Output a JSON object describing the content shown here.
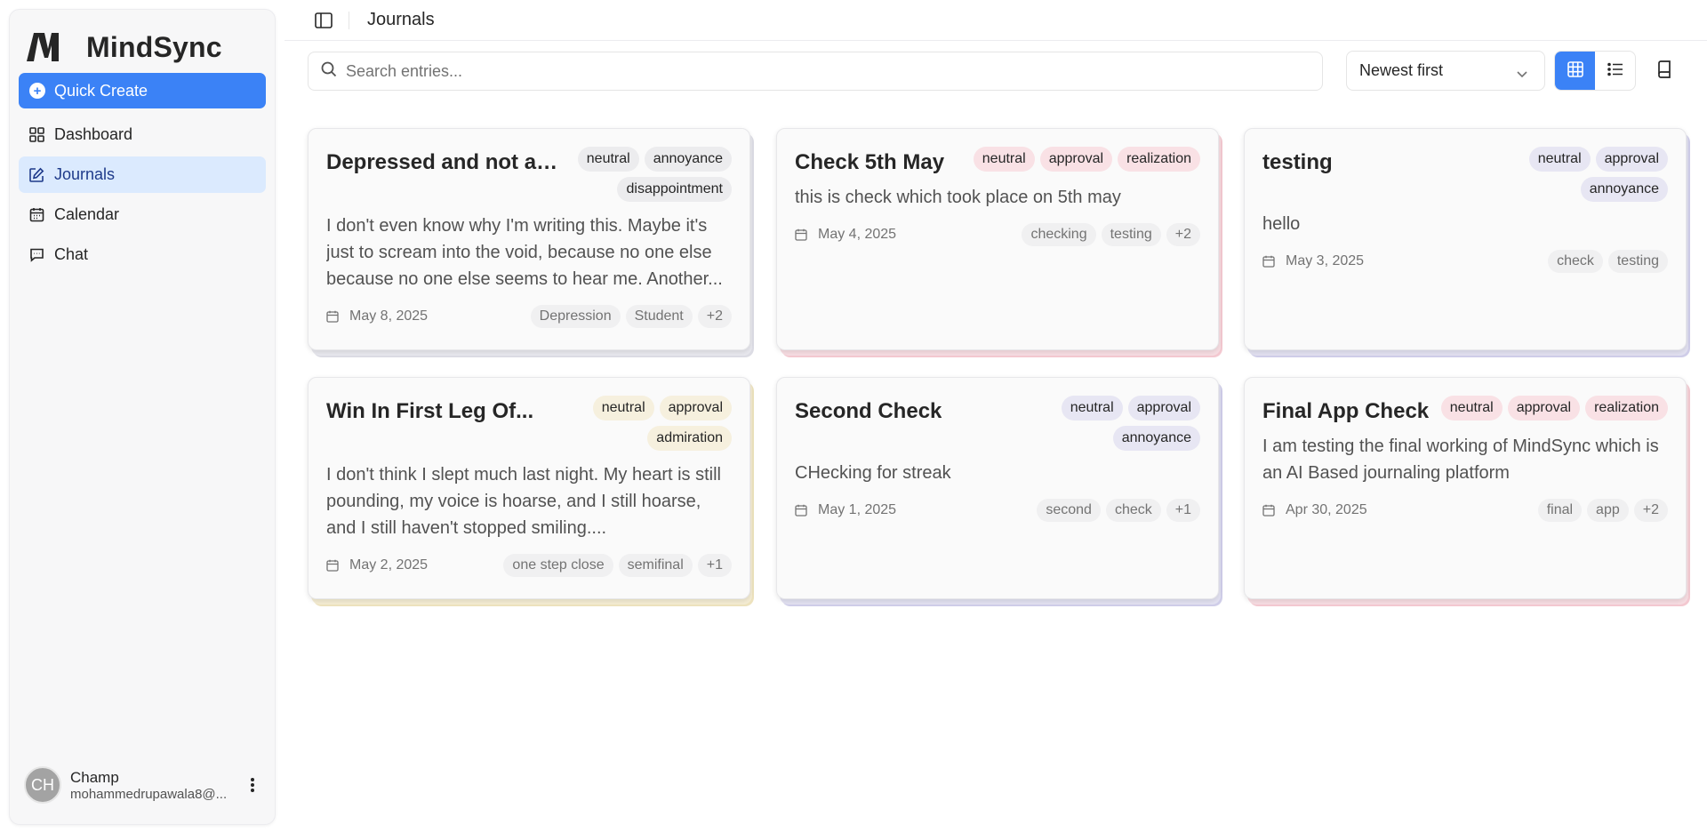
{
  "app": {
    "name": "MindSync"
  },
  "sidebar": {
    "quick_create": "Quick Create",
    "items": [
      {
        "label": "Dashboard",
        "icon": "dashboard-icon"
      },
      {
        "label": "Journals",
        "icon": "journal-edit-icon",
        "active": true
      },
      {
        "label": "Calendar",
        "icon": "calendar-icon"
      },
      {
        "label": "Chat",
        "icon": "chat-icon"
      }
    ],
    "user": {
      "initials": "CH",
      "name": "Champ",
      "email": "mohammedrupawala8@..."
    }
  },
  "header": {
    "title": "Journals"
  },
  "toolbar": {
    "search_placeholder": "Search entries...",
    "sort_value": "Newest first",
    "view_mode": "grid"
  },
  "colors": {
    "accent": "#3b82f6",
    "active_nav": "#dbeafe"
  },
  "entries": [
    {
      "title": "Depressed and not able...",
      "emotions": [
        "neutral",
        "annoyance",
        "disappointment"
      ],
      "emotion_tone": "gray",
      "body": "I don't even know why I'm writing this. Maybe it's just to scream into the void, because no one else because no one else seems to hear me. Another...",
      "date": "May 8, 2025",
      "tags": [
        "Depression",
        "Student",
        "+2"
      ]
    },
    {
      "title": "Check 5th May",
      "emotions": [
        "neutral",
        "approval",
        "realization"
      ],
      "emotion_tone": "pink",
      "body": "this is check which took place on 5th may",
      "date": "May 4, 2025",
      "tags": [
        "checking",
        "testing",
        "+2"
      ]
    },
    {
      "title": "testing",
      "emotions": [
        "neutral",
        "approval",
        "annoyance"
      ],
      "emotion_tone": "lavender",
      "body": "hello",
      "date": "May 3, 2025",
      "tags": [
        "check",
        "testing"
      ]
    },
    {
      "title": "Win In First Leg Of...",
      "emotions": [
        "neutral",
        "approval",
        "admiration"
      ],
      "emotion_tone": "cream",
      "body": "I don't think I slept much last night. My heart is still pounding, my voice is hoarse, and I still hoarse, and I still haven't stopped smiling....",
      "date": "May 2, 2025",
      "tags": [
        "one step close",
        "semifinal",
        "+1"
      ]
    },
    {
      "title": "Second Check",
      "emotions": [
        "neutral",
        "approval",
        "annoyance"
      ],
      "emotion_tone": "lavender",
      "body": "CHecking for streak",
      "date": "May 1, 2025",
      "tags": [
        "second",
        "check",
        "+1"
      ]
    },
    {
      "title": "Final App Check",
      "emotions": [
        "neutral",
        "approval",
        "realization"
      ],
      "emotion_tone": "pink",
      "body": "I am testing the final working of MindSync which is an AI Based journaling platform",
      "date": "Apr 30, 2025",
      "tags": [
        "final",
        "app",
        "+2"
      ]
    }
  ]
}
